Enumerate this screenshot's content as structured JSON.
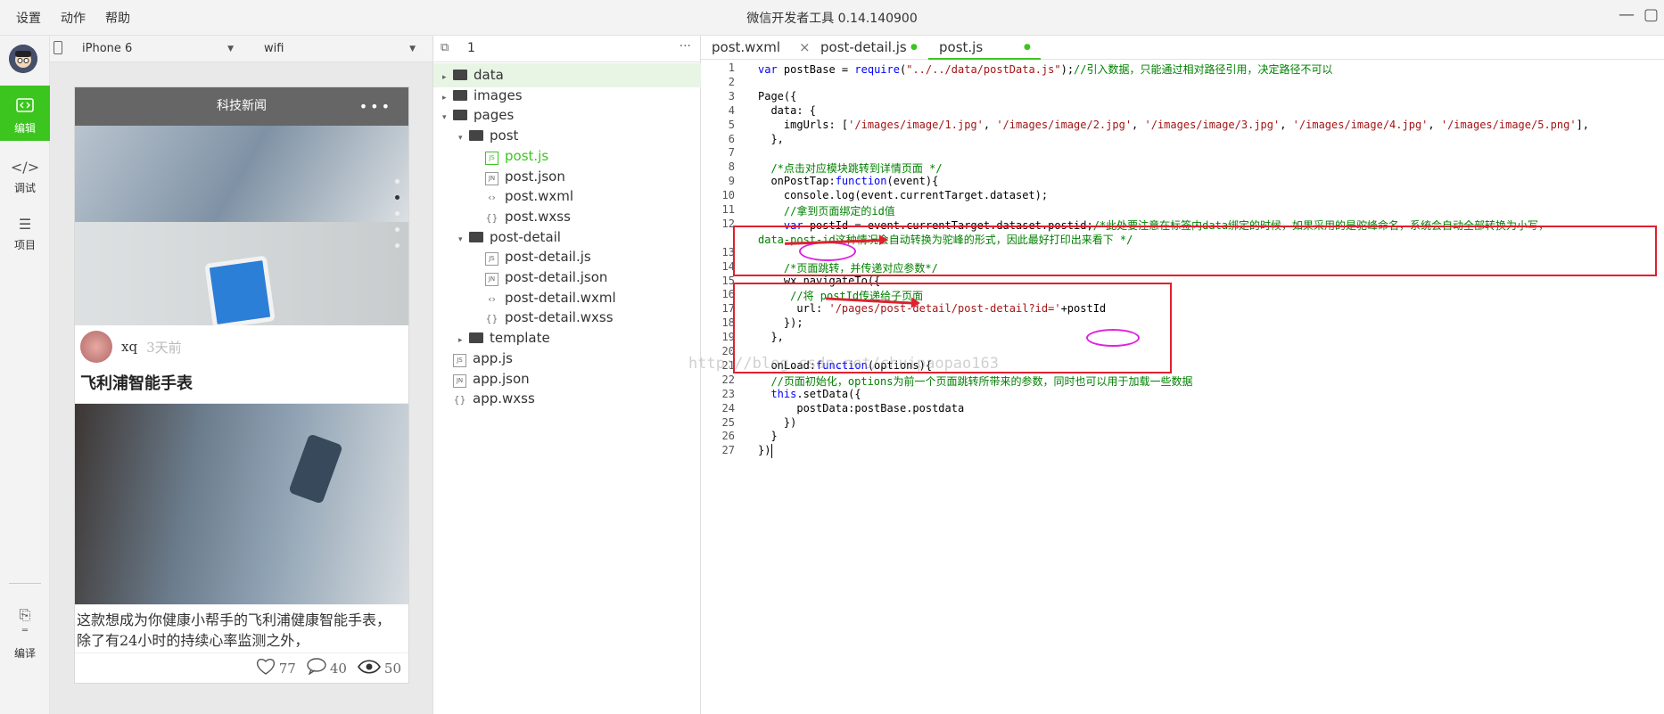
{
  "menu": [
    "设置",
    "动作",
    "帮助"
  ],
  "window_title": "微信开发者工具 0.14.140900",
  "side_nav": [
    {
      "label": "编辑",
      "icon": "code-icon",
      "active": true
    },
    {
      "label": "调试",
      "icon": "debug-icon",
      "active": false
    },
    {
      "label": "项目",
      "icon": "list-icon",
      "active": false
    },
    {
      "label": "编译",
      "icon": "compile-icon",
      "active": false
    }
  ],
  "simulator": {
    "device": "iPhone 6",
    "network": "wifi",
    "nav_title": "科技新闻",
    "post": {
      "author": "xq",
      "time": "3天前",
      "title": "飞利浦智能手表",
      "content": "这款想成为你健康小帮手的飞利浦健康智能手表，除了有24小时的持续心率监测之外，",
      "likes": "77",
      "comments": "40",
      "views": "50"
    }
  },
  "tree": {
    "header_number": "1",
    "items": [
      {
        "label": "data",
        "type": "folder",
        "open": false
      },
      {
        "label": "images",
        "type": "folder",
        "open": false
      },
      {
        "label": "pages",
        "type": "folder",
        "open": true
      },
      {
        "label": "post",
        "type": "folder",
        "open": true
      },
      {
        "label": "post.js",
        "type": "js"
      },
      {
        "label": "post.json",
        "type": "json"
      },
      {
        "label": "post.wxml",
        "type": "wxml"
      },
      {
        "label": "post.wxss",
        "type": "wxss"
      },
      {
        "label": "post-detail",
        "type": "folder",
        "open": true
      },
      {
        "label": "post-detail.js",
        "type": "js"
      },
      {
        "label": "post-detail.json",
        "type": "json"
      },
      {
        "label": "post-detail.wxml",
        "type": "wxml"
      },
      {
        "label": "post-detail.wxss",
        "type": "wxss"
      },
      {
        "label": "template",
        "type": "folder",
        "open": false
      },
      {
        "label": "app.js",
        "type": "js"
      },
      {
        "label": "app.json",
        "type": "json"
      },
      {
        "label": "app.wxss",
        "type": "wxss"
      }
    ]
  },
  "tabs": [
    "post.wxml",
    "post-detail.js",
    "post.js"
  ],
  "code": [
    {
      "n": "1",
      "html": "<span class=\"kw\">var</span> postBase = <span class=\"kw\">require</span>(<span class=\"str\">\"../../data/postData.js\"</span>);<span class=\"com\">//引入数据，只能通过相对路径引用，决定路径不可以</span>"
    },
    {
      "n": "2",
      "html": ""
    },
    {
      "n": "3",
      "html": "Page({"
    },
    {
      "n": "4",
      "html": "  data: {"
    },
    {
      "n": "5",
      "html": "    imgUrls: [<span class=\"str\">'/images/image/1.jpg'</span>, <span class=\"str\">'/images/image/2.jpg'</span>, <span class=\"str\">'/images/image/3.jpg'</span>, <span class=\"str\">'/images/image/4.jpg'</span>, <span class=\"str\">'/images/image/5.png'</span>],"
    },
    {
      "n": "6",
      "html": "  },"
    },
    {
      "n": "7",
      "html": ""
    },
    {
      "n": "8",
      "html": "  <span class=\"com\">/*点击对应模块跳转到详情页面 */</span>"
    },
    {
      "n": "9",
      "html": "  onPostTap:<span class=\"kw\">function</span>(event){"
    },
    {
      "n": "10",
      "html": "    console.log(event.currentTarget.dataset);"
    },
    {
      "n": "11",
      "html": "    <span class=\"com\">//拿到页面绑定的id值</span>"
    },
    {
      "n": "12",
      "html": "    <span class=\"kw\">var</span> postId = event.currentTarget.dataset.postid;<span class=\"com\">/*此处要注意在标签内data绑定的时候，如果采用的是驼峰命名，系统会自动全部转换为小写，</span>"
    },
    {
      "n": "",
      "html": "<span class=\"com\">data-post-id这种情况会自动转换为驼峰的形式，因此最好打印出来看下 */</span>"
    },
    {
      "n": "13",
      "html": ""
    },
    {
      "n": "14",
      "html": "    <span class=\"com\">/*页面跳转，并传递对应参数*/</span>"
    },
    {
      "n": "15",
      "html": "    wx.navigateTo({"
    },
    {
      "n": "16",
      "html": "     <span class=\"com\">//将 postId传递给子页面</span>"
    },
    {
      "n": "17",
      "html": "      url: <span class=\"str\">'/pages/post-detail/post-detail?id='</span>+postId"
    },
    {
      "n": "18",
      "html": "    });"
    },
    {
      "n": "19",
      "html": "  },"
    },
    {
      "n": "20",
      "html": ""
    },
    {
      "n": "21",
      "html": "  onLoad:<span class=\"kw\">function</span>(options){"
    },
    {
      "n": "22",
      "html": "  <span class=\"com\">//页面初始化，options为前一个页面跳转所带来的参数，同时也可以用于加载一些数据</span>"
    },
    {
      "n": "23",
      "html": "  <span class=\"kw\">this</span>.setData({"
    },
    {
      "n": "24",
      "html": "      postData:postBase.postdata"
    },
    {
      "n": "25",
      "html": "    })"
    },
    {
      "n": "26",
      "html": "  }"
    },
    {
      "n": "27",
      "html": "})"
    }
  ],
  "watermark": "http://blog.csdn.net/chuipaopao163"
}
